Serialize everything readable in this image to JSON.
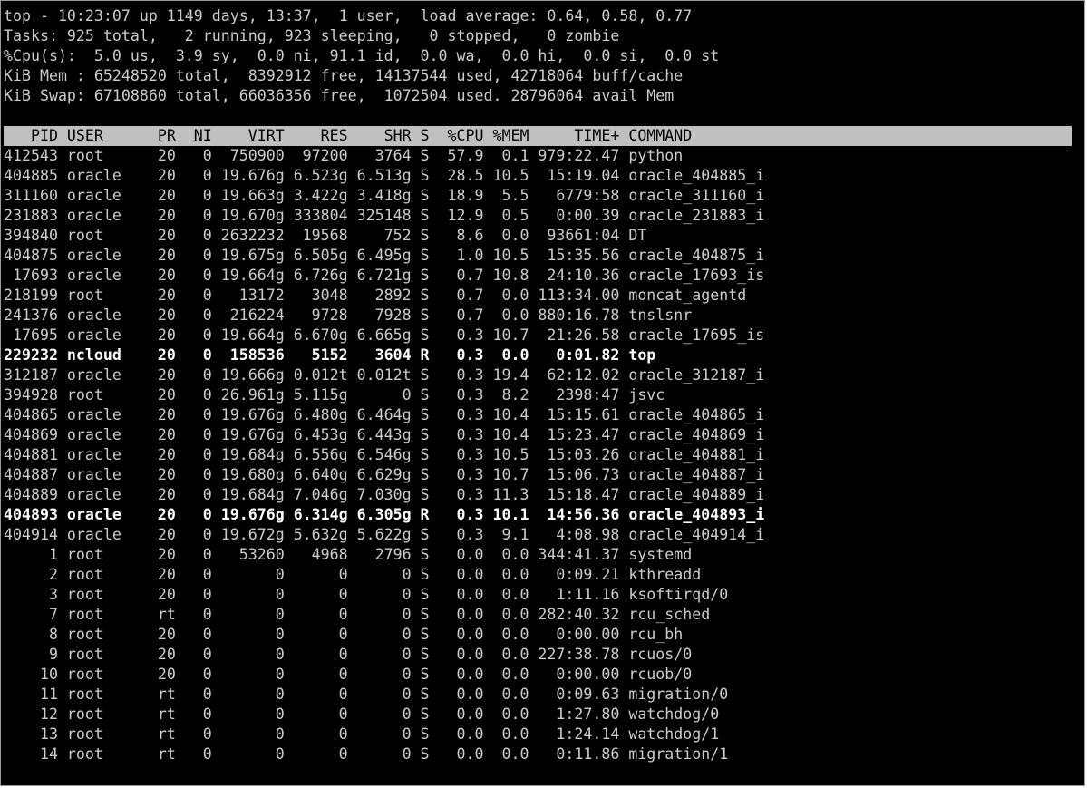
{
  "summary": {
    "uptime_line": "top - 10:23:07 up 1149 days, 13:37,  1 user,  load average: 0.64, 0.58, 0.77",
    "tasks_line": "Tasks: 925 total,   2 running, 923 sleeping,   0 stopped,   0 zombie",
    "cpu_line": "%Cpu(s):  5.0 us,  3.9 sy,  0.0 ni, 91.1 id,  0.0 wa,  0.0 hi,  0.0 si,  0.0 st",
    "mem_line": "KiB Mem : 65248520 total,  8392912 free, 14137544 used, 42718064 buff/cache",
    "swap_line": "KiB Swap: 67108860 total, 66036356 free,  1072504 used. 28796064 avail Mem"
  },
  "table": {
    "header": "   PID USER      PR  NI    VIRT    RES    SHR S  %CPU %MEM     TIME+ COMMAND",
    "rows": [
      {
        "text": "412543 root      20   0  750900  97200   3764 S  57.9  0.1 979:22.47 python",
        "bold": false
      },
      {
        "text": "404885 oracle    20   0 19.676g 6.523g 6.513g S  28.5 10.5  15:19.04 oracle_404885_i",
        "bold": false
      },
      {
        "text": "311160 oracle    20   0 19.663g 3.422g 3.418g S  18.9  5.5   6779:58 oracle_311160_i",
        "bold": false
      },
      {
        "text": "231883 oracle    20   0 19.670g 333804 325148 S  12.9  0.5   0:00.39 oracle_231883_i",
        "bold": false
      },
      {
        "text": "394840 root      20   0 2632232  19568    752 S   8.6  0.0  93661:04 DT",
        "bold": false
      },
      {
        "text": "404875 oracle    20   0 19.675g 6.505g 6.495g S   1.0 10.5  15:35.56 oracle_404875_i",
        "bold": false
      },
      {
        "text": " 17693 oracle    20   0 19.664g 6.726g 6.721g S   0.7 10.8  24:10.36 oracle_17693_is",
        "bold": false
      },
      {
        "text": "218199 root      20   0   13172   3048   2892 S   0.7  0.0 113:34.00 moncat_agentd",
        "bold": false
      },
      {
        "text": "241376 oracle    20   0  216224   9728   7928 S   0.7  0.0 880:16.78 tnslsnr",
        "bold": false
      },
      {
        "text": " 17695 oracle    20   0 19.664g 6.670g 6.665g S   0.3 10.7  21:26.58 oracle_17695_is",
        "bold": false
      },
      {
        "text": "229232 ncloud    20   0  158536   5152   3604 R   0.3  0.0   0:01.82 top",
        "bold": true
      },
      {
        "text": "312187 oracle    20   0 19.666g 0.012t 0.012t S   0.3 19.4  62:12.02 oracle_312187_i",
        "bold": false
      },
      {
        "text": "394928 root      20   0 26.961g 5.115g      0 S   0.3  8.2   2398:47 jsvc",
        "bold": false
      },
      {
        "text": "404865 oracle    20   0 19.676g 6.480g 6.464g S   0.3 10.4  15:15.61 oracle_404865_i",
        "bold": false
      },
      {
        "text": "404869 oracle    20   0 19.676g 6.453g 6.443g S   0.3 10.4  15:23.47 oracle_404869_i",
        "bold": false
      },
      {
        "text": "404881 oracle    20   0 19.684g 6.556g 6.546g S   0.3 10.5  15:03.26 oracle_404881_i",
        "bold": false
      },
      {
        "text": "404887 oracle    20   0 19.680g 6.640g 6.629g S   0.3 10.7  15:06.73 oracle_404887_i",
        "bold": false
      },
      {
        "text": "404889 oracle    20   0 19.684g 7.046g 7.030g S   0.3 11.3  15:18.47 oracle_404889_i",
        "bold": false
      },
      {
        "text": "404893 oracle    20   0 19.676g 6.314g 6.305g R   0.3 10.1  14:56.36 oracle_404893_i",
        "bold": true
      },
      {
        "text": "404914 oracle    20   0 19.672g 5.632g 5.622g S   0.3  9.1   4:08.98 oracle_404914_i",
        "bold": false
      },
      {
        "text": "     1 root      20   0   53260   4968   2796 S   0.0  0.0 344:41.37 systemd",
        "bold": false
      },
      {
        "text": "     2 root      20   0       0      0      0 S   0.0  0.0   0:09.21 kthreadd",
        "bold": false
      },
      {
        "text": "     3 root      20   0       0      0      0 S   0.0  0.0   1:11.16 ksoftirqd/0",
        "bold": false
      },
      {
        "text": "     7 root      rt   0       0      0      0 S   0.0  0.0 282:40.32 rcu_sched",
        "bold": false
      },
      {
        "text": "     8 root      20   0       0      0      0 S   0.0  0.0   0:00.00 rcu_bh",
        "bold": false
      },
      {
        "text": "     9 root      20   0       0      0      0 S   0.0  0.0 227:38.78 rcuos/0",
        "bold": false
      },
      {
        "text": "    10 root      20   0       0      0      0 S   0.0  0.0   0:00.00 rcuob/0",
        "bold": false
      },
      {
        "text": "    11 root      rt   0       0      0      0 S   0.0  0.0   0:09.63 migration/0",
        "bold": false
      },
      {
        "text": "    12 root      rt   0       0      0      0 S   0.0  0.0   1:27.80 watchdog/0",
        "bold": false
      },
      {
        "text": "    13 root      rt   0       0      0      0 S   0.0  0.0   1:24.14 watchdog/1",
        "bold": false
      },
      {
        "text": "    14 root      rt   0       0      0      0 S   0.0  0.0   0:11.86 migration/1",
        "bold": false
      }
    ]
  }
}
